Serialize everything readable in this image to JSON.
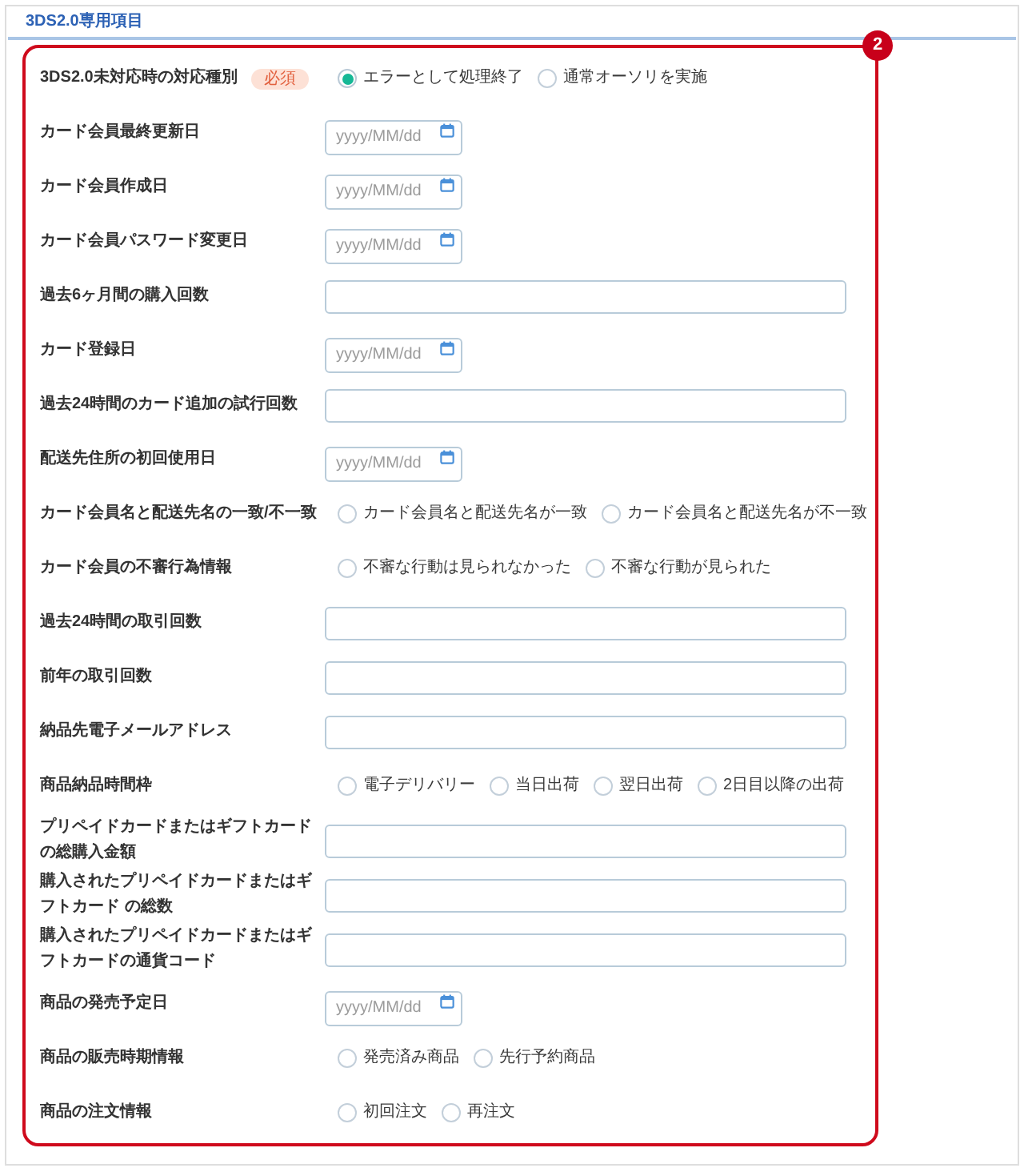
{
  "section": {
    "title": "3DS2.0専用項目"
  },
  "annotation": {
    "number": "2"
  },
  "fields": [
    {
      "kind": "radio",
      "label": "3DS2.0未対応時の対応種別",
      "badge": "必須",
      "options": [
        {
          "label": "エラーとして処理終了",
          "selected": true
        },
        {
          "label": "通常オーソリを実施",
          "selected": false
        }
      ]
    },
    {
      "kind": "date",
      "label": "カード会員最終更新日",
      "placeholder": "yyyy/MM/dd"
    },
    {
      "kind": "date",
      "label": "カード会員作成日",
      "placeholder": "yyyy/MM/dd"
    },
    {
      "kind": "date",
      "label": "カード会員パスワード変更日",
      "placeholder": "yyyy/MM/dd"
    },
    {
      "kind": "text",
      "label": "過去6ヶ月間の購入回数"
    },
    {
      "kind": "date",
      "label": "カード登録日",
      "placeholder": "yyyy/MM/dd"
    },
    {
      "kind": "text",
      "label": "過去24時間のカード追加の試行回数"
    },
    {
      "kind": "date",
      "label": "配送先住所の初回使用日",
      "placeholder": "yyyy/MM/dd"
    },
    {
      "kind": "radio",
      "label": "カード会員名と配送先名の一致/不一致",
      "options": [
        {
          "label": "カード会員名と配送先名が一致",
          "selected": false
        },
        {
          "label": "カード会員名と配送先名が不一致",
          "selected": false
        }
      ]
    },
    {
      "kind": "radio",
      "label": "カード会員の不審行為情報",
      "options": [
        {
          "label": "不審な行動は見られなかった",
          "selected": false
        },
        {
          "label": "不審な行動が見られた",
          "selected": false
        }
      ]
    },
    {
      "kind": "text",
      "label": "過去24時間の取引回数"
    },
    {
      "kind": "text",
      "label": "前年の取引回数"
    },
    {
      "kind": "text",
      "label": "納品先電子メールアドレス"
    },
    {
      "kind": "radio",
      "label": "商品納品時間枠",
      "options": [
        {
          "label": "電子デリバリー",
          "selected": false
        },
        {
          "label": "当日出荷",
          "selected": false
        },
        {
          "label": "翌日出荷",
          "selected": false
        },
        {
          "label": "2日目以降の出荷",
          "selected": false
        }
      ]
    },
    {
      "kind": "text",
      "label": "プリペイドカードまたはギフトカードの総購入金額"
    },
    {
      "kind": "text",
      "label": "購入されたプリペイドカードまたはギフトカード の総数"
    },
    {
      "kind": "text",
      "label": "購入されたプリペイドカードまたはギフトカードの通貨コード"
    },
    {
      "kind": "date",
      "label": "商品の発売予定日",
      "placeholder": "yyyy/MM/dd"
    },
    {
      "kind": "radio",
      "label": "商品の販売時期情報",
      "options": [
        {
          "label": "発売済み商品",
          "selected": false
        },
        {
          "label": "先行予約商品",
          "selected": false
        }
      ]
    },
    {
      "kind": "radio",
      "label": "商品の注文情報",
      "options": [
        {
          "label": "初回注文",
          "selected": false
        },
        {
          "label": "再注文",
          "selected": false
        }
      ]
    }
  ]
}
